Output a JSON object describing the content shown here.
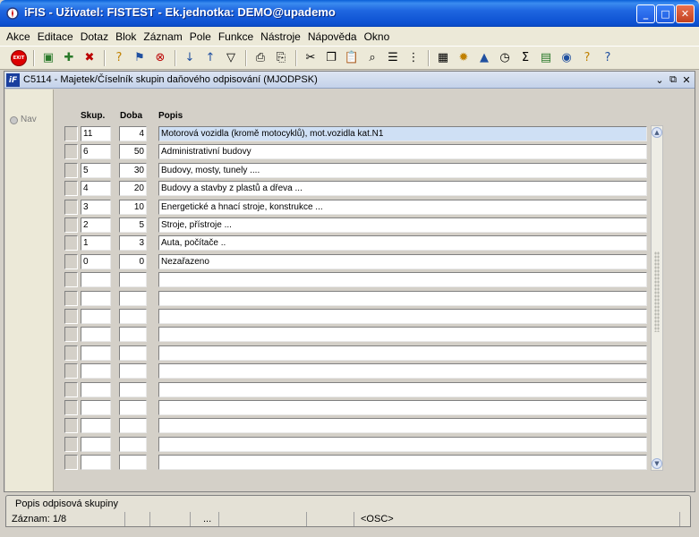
{
  "window": {
    "title": "iFIS - Uživatel: FISTEST - Ek.jednotka: DEMO@upademo",
    "minimize_label": "_",
    "maximize_label": "□",
    "close_label": "✕"
  },
  "menu": [
    "Akce",
    "Editace",
    "Dotaz",
    "Blok",
    "Záznam",
    "Pole",
    "Funkce",
    "Nástroje",
    "Nápověda",
    "Okno"
  ],
  "toolbar": {
    "exit_label": "EXIT",
    "icons": [
      "exit-icon",
      "save-icon",
      "new-record-icon",
      "delete-record-icon",
      "query-icon",
      "execute-query-icon",
      "cancel-query-icon",
      "sort-ascending-icon",
      "sort-descending-icon",
      "filter-icon",
      "print-icon",
      "print-preview-icon",
      "cut-icon",
      "copy-icon",
      "paste-icon",
      "search-icon",
      "list-icon",
      "tree-icon",
      "calculator-icon",
      "settings-icon",
      "alert-icon",
      "clock-icon",
      "sum-icon",
      "excel-icon",
      "web-icon",
      "user-help-icon",
      "help-icon"
    ]
  },
  "form": {
    "title": "C5114 - Majetek/Číselník skupin daňového odpisování (MJODPSK)",
    "nav_label": "Nav",
    "columns": {
      "skup": "Skup.",
      "doba": "Doba",
      "popis": "Popis"
    },
    "rows": [
      {
        "skup": "11",
        "doba": "4",
        "popis": "Motorová vozidla (kromě motocyklů), mot.vozidla kat.N1"
      },
      {
        "skup": "6",
        "doba": "50",
        "popis": "Administrativní budovy"
      },
      {
        "skup": "5",
        "doba": "30",
        "popis": "Budovy, mosty, tunely ...."
      },
      {
        "skup": "4",
        "doba": "20",
        "popis": "Budovy a stavby z plastů a dřeva ..."
      },
      {
        "skup": "3",
        "doba": "10",
        "popis": "Energetické a hnací stroje, konstrukce ..."
      },
      {
        "skup": "2",
        "doba": "5",
        "popis": "Stroje, přístroje ..."
      },
      {
        "skup": "1",
        "doba": "3",
        "popis": "Auta, počítače .."
      },
      {
        "skup": "0",
        "doba": "0",
        "popis": "Nezařazeno"
      },
      {
        "skup": "",
        "doba": "",
        "popis": ""
      },
      {
        "skup": "",
        "doba": "",
        "popis": ""
      },
      {
        "skup": "",
        "doba": "",
        "popis": ""
      },
      {
        "skup": "",
        "doba": "",
        "popis": ""
      },
      {
        "skup": "",
        "doba": "",
        "popis": ""
      },
      {
        "skup": "",
        "doba": "",
        "popis": ""
      },
      {
        "skup": "",
        "doba": "",
        "popis": ""
      },
      {
        "skup": "",
        "doba": "",
        "popis": ""
      },
      {
        "skup": "",
        "doba": "",
        "popis": ""
      },
      {
        "skup": "",
        "doba": "",
        "popis": ""
      },
      {
        "skup": "",
        "doba": "",
        "popis": ""
      }
    ]
  },
  "hint": "Popis odpisová skupiny",
  "status": {
    "record": "Záznam: 1/8",
    "dots": "...",
    "osc": "<OSC>"
  },
  "colors": {
    "titlebar": "#1e66e0",
    "active_row": "#cfe0f5",
    "form_bg": "#d4d0c8"
  }
}
